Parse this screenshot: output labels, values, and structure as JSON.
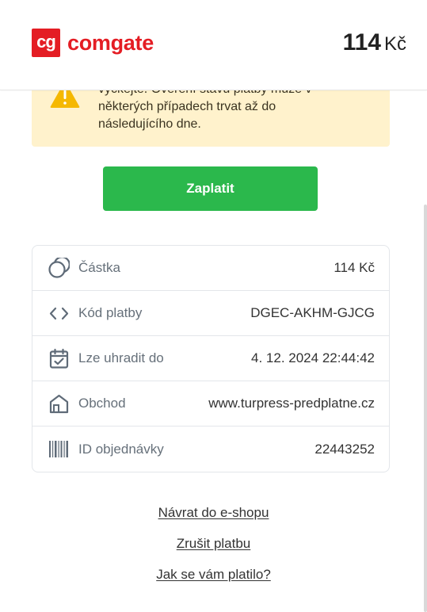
{
  "header": {
    "logo_badge": "cg",
    "logo_text": "comgate",
    "amount_number": "114",
    "amount_currency": "Kč"
  },
  "warning": {
    "text": "vyčkejte. Ověření stavu platby může v některých případech trvat až do následujícího dne."
  },
  "pay_button": {
    "label": "Zaplatit"
  },
  "details": [
    {
      "icon": "coins-icon",
      "label": "Částka",
      "value": "114 Kč"
    },
    {
      "icon": "code-icon",
      "label": "Kód platby",
      "value": "DGEC-AKHM-GJCG"
    },
    {
      "icon": "calendar-check-icon",
      "label": "Lze uhradit do",
      "value": "4. 12. 2024 22:44:42"
    },
    {
      "icon": "store-icon",
      "label": "Obchod",
      "value": "www.turpress-predplatne.cz"
    },
    {
      "icon": "barcode-icon",
      "label": "ID objednávky",
      "value": "22443252"
    }
  ],
  "links": {
    "return": "Návrat do e-shopu",
    "cancel": "Zrušit platbu",
    "feedback": "Jak se vám platilo?"
  },
  "colors": {
    "brand": "#e41d24",
    "pay_button": "#2bb84c",
    "warning_bg": "#fff2cc",
    "warning_icon": "#f5b800",
    "icon_gray": "#5f6b78"
  }
}
